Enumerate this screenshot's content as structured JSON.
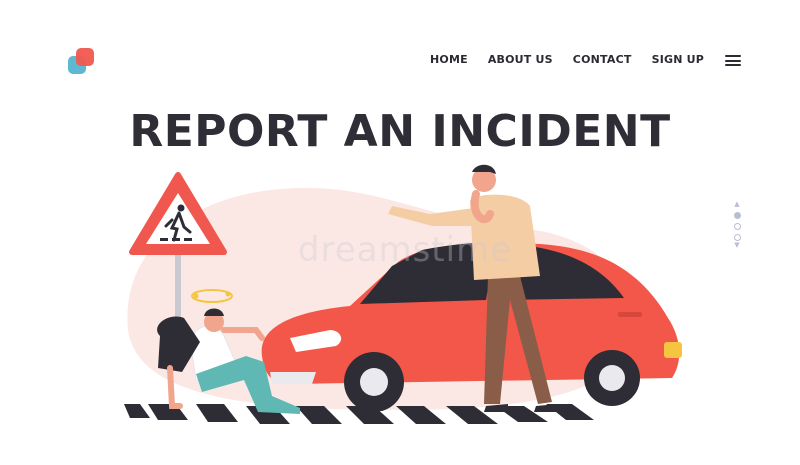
{
  "header": {
    "nav": [
      {
        "label": "HOME"
      },
      {
        "label": "ABOUT US"
      },
      {
        "label": "CONTACT"
      },
      {
        "label": "SIGN UP"
      }
    ]
  },
  "hero": {
    "title": "REPORT AN INCIDENT",
    "watermark": "dreamstime"
  },
  "colors": {
    "accent": "#f0584f",
    "secondary": "#5fb8d2",
    "text": "#2f2e36",
    "car": "#f2574a"
  },
  "icons": [
    "logo-icon",
    "menu-icon",
    "pedestrian-crossing-sign-icon"
  ],
  "pager": {
    "count": 3,
    "active_index": 0
  }
}
